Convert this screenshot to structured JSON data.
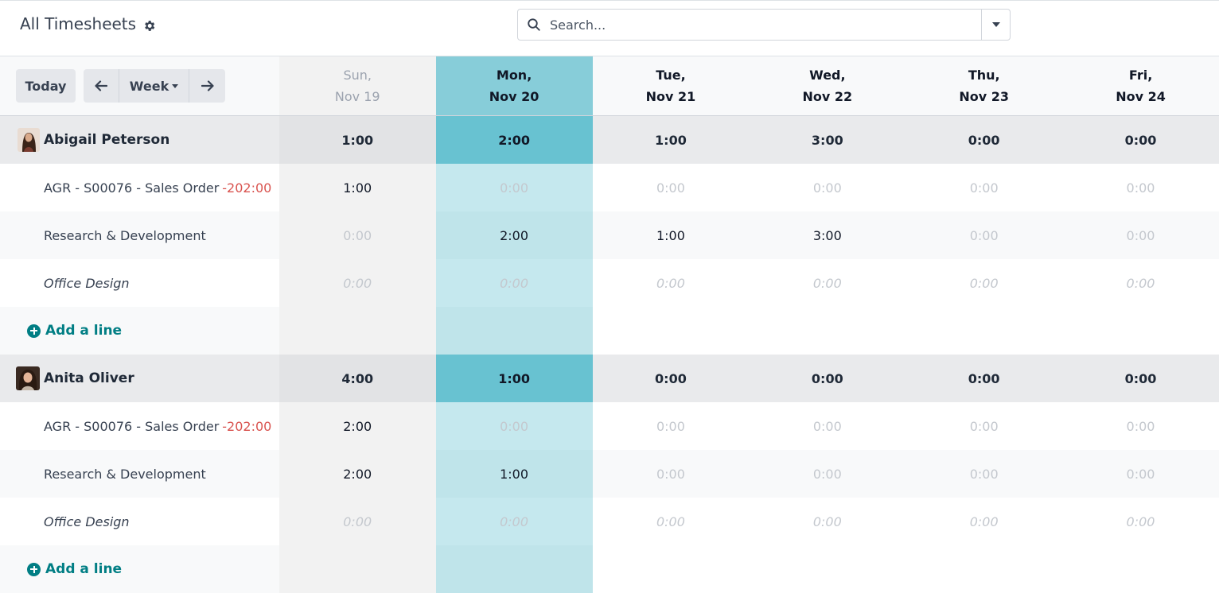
{
  "header": {
    "title": "All Timesheets",
    "settings_icon": "gear-icon"
  },
  "search": {
    "placeholder": "Search...",
    "icon": "search-icon",
    "toggle_icon": "caret-down-icon"
  },
  "toolbar": {
    "today_label": "Today",
    "prev_icon": "arrow-left-icon",
    "period_label": "Week",
    "next_icon": "arrow-right-icon"
  },
  "days": [
    {
      "day": "Sun,",
      "date": "Nov 19"
    },
    {
      "day": "Mon,",
      "date": "Nov 20"
    },
    {
      "day": "Tue,",
      "date": "Nov 21"
    },
    {
      "day": "Wed,",
      "date": "Nov 22"
    },
    {
      "day": "Thu,",
      "date": "Nov 23"
    },
    {
      "day": "Fri,",
      "date": "Nov 24"
    }
  ],
  "groups": [
    {
      "employee": "Abigail Peterson",
      "totals": [
        "1:00",
        "2:00",
        "1:00",
        "3:00",
        "0:00",
        "0:00"
      ],
      "lines": [
        {
          "name": "AGR - S00076 - Sales Order",
          "badge": "-202:00",
          "values": [
            "1:00",
            "0:00",
            "0:00",
            "0:00",
            "0:00",
            "0:00"
          ]
        },
        {
          "name": "Research & Development",
          "values": [
            "0:00",
            "2:00",
            "1:00",
            "3:00",
            "0:00",
            "0:00"
          ]
        },
        {
          "name": "Office Design",
          "values": [
            "0:00",
            "0:00",
            "0:00",
            "0:00",
            "0:00",
            "0:00"
          ]
        }
      ],
      "add_label": "Add a line"
    },
    {
      "employee": "Anita Oliver",
      "totals": [
        "4:00",
        "1:00",
        "0:00",
        "0:00",
        "0:00",
        "0:00"
      ],
      "lines": [
        {
          "name": "AGR - S00076 - Sales Order",
          "badge": "-202:00",
          "values": [
            "2:00",
            "0:00",
            "0:00",
            "0:00",
            "0:00",
            "0:00"
          ]
        },
        {
          "name": "Research & Development",
          "values": [
            "2:00",
            "1:00",
            "0:00",
            "0:00",
            "0:00",
            "0:00"
          ]
        },
        {
          "name": "Office Design",
          "values": [
            "0:00",
            "0:00",
            "0:00",
            "0:00",
            "0:00",
            "0:00"
          ]
        }
      ],
      "add_label": "Add a line"
    }
  ],
  "colors": {
    "today_header": "#87cdd9",
    "today_group": "#68c2d1",
    "accent": "#017e84",
    "negative": "#d9534f"
  }
}
